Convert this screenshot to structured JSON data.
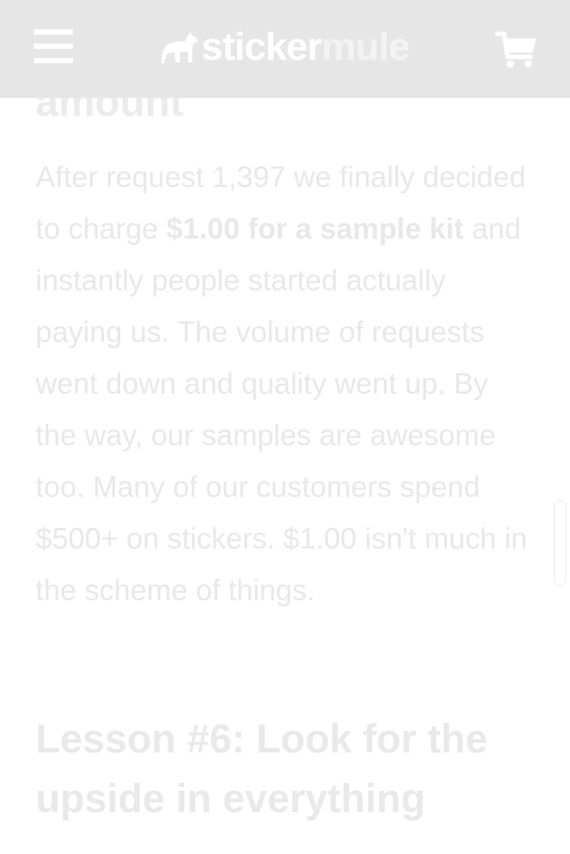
{
  "header": {
    "logo": {
      "part1": "sticker",
      "part2": "mule"
    },
    "menu_icon": "hamburger-menu-icon",
    "cart_icon": "shopping-cart-icon",
    "background": "#e6e6e6"
  },
  "article": {
    "previous_heading_fragment": "amount",
    "paragraph": {
      "before_bold": "After request 1,397 we finally decided to charge ",
      "bold": "$1.00 for a sample kit",
      "after_bold": " and instantly people started actually paying us. The volume of requests went down and quality went up. By the way, our samples are awesome too. Many of our customers spend $500+ on stickers. $1.00 isn't much in the scheme of things."
    },
    "next_heading": "Lesson #6: Look for the upside in everything"
  },
  "colors": {
    "header_bg": "#e6e6e6",
    "text_faded": "#e8e8e8",
    "page_bg": "#ffffff"
  }
}
